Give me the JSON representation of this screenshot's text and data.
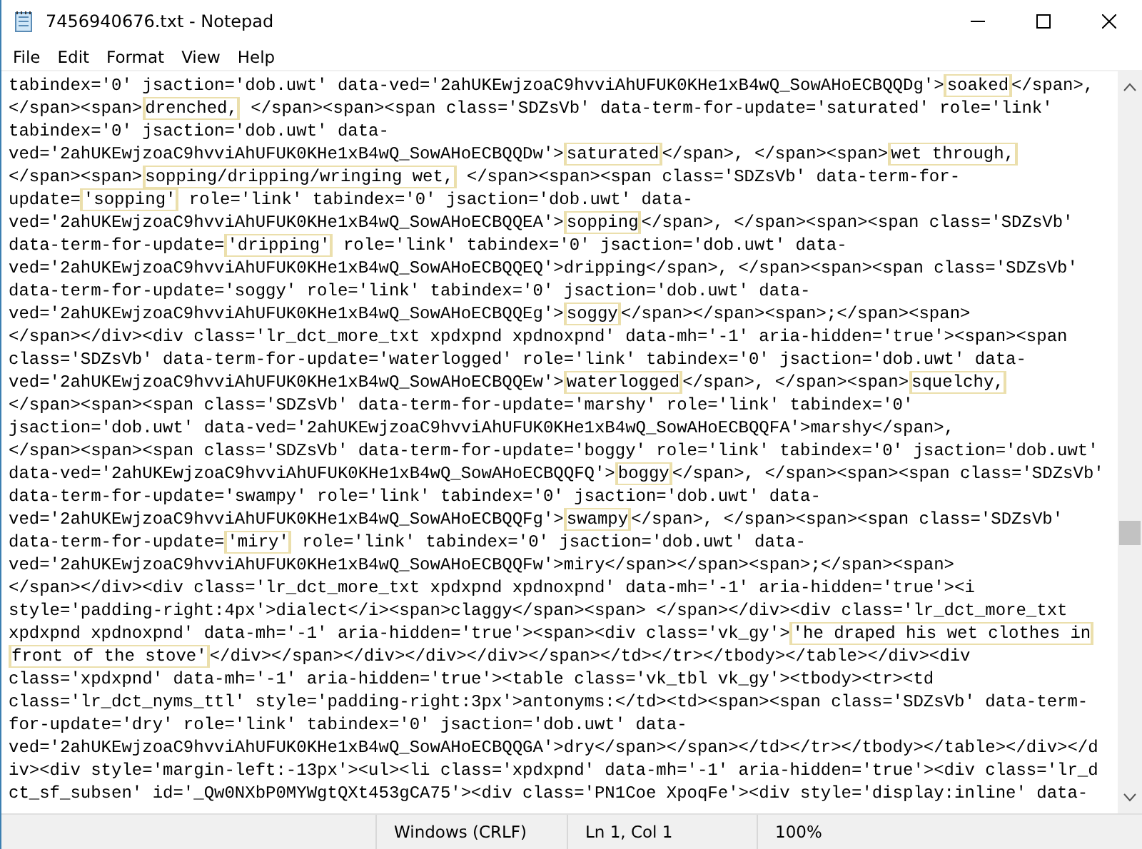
{
  "window": {
    "title": "7456940676.txt - Notepad"
  },
  "menu": [
    "File",
    "Edit",
    "Format",
    "View",
    "Help"
  ],
  "lines": [
    {
      "segments": [
        {
          "text": "tabindex='0' jsaction='dob.uwt' data-ved='2ahUKEwjzoaC9hvviAhUFUK0KHe1xB4wQ_SowAHoECBQQDg'>",
          "highlighted": false
        },
        {
          "text": "soaked",
          "highlighted": true
        },
        {
          "text": "</span>,",
          "highlighted": false
        }
      ]
    },
    {
      "segments": [
        {
          "text": "</span><span>",
          "highlighted": false
        },
        {
          "text": "drenched,",
          "highlighted": true
        },
        {
          "text": " </span><span><span class='SDZsVb' data-term-for-update='saturated' role='link'",
          "highlighted": false
        }
      ]
    },
    {
      "segments": [
        {
          "text": "tabindex='0' jsaction='dob.uwt' data-",
          "highlighted": false
        }
      ]
    },
    {
      "segments": [
        {
          "text": "ved='2ahUKEwjzoaC9hvviAhUFUK0KHe1xB4wQ_SowAHoECBQQDw'>",
          "highlighted": false
        },
        {
          "text": "saturated",
          "highlighted": true
        },
        {
          "text": "</span>, </span><span>",
          "highlighted": false
        },
        {
          "text": "wet through,",
          "highlighted": true
        }
      ]
    },
    {
      "segments": [
        {
          "text": "</span><span>",
          "highlighted": false
        },
        {
          "text": "sopping/dripping/wringing wet,",
          "highlighted": true
        },
        {
          "text": " </span><span><span class='SDZsVb' data-term-for-",
          "highlighted": false
        }
      ]
    },
    {
      "segments": [
        {
          "text": "update=",
          "highlighted": false
        },
        {
          "text": "'sopping'",
          "highlighted": true
        },
        {
          "text": " role='link' tabindex='0' jsaction='dob.uwt' data-",
          "highlighted": false
        }
      ]
    },
    {
      "segments": [
        {
          "text": "ved='2ahUKEwjzoaC9hvviAhUFUK0KHe1xB4wQ_SowAHoECBQQEA'>",
          "highlighted": false
        },
        {
          "text": "sopping",
          "highlighted": true
        },
        {
          "text": "</span>, </span><span><span class='SDZsVb'",
          "highlighted": false
        }
      ]
    },
    {
      "segments": [
        {
          "text": "data-term-for-update=",
          "highlighted": false
        },
        {
          "text": "'dripping'",
          "highlighted": true
        },
        {
          "text": " role='link' tabindex='0' jsaction='dob.uwt' data-",
          "highlighted": false
        }
      ]
    },
    {
      "segments": [
        {
          "text": "ved='2ahUKEwjzoaC9hvviAhUFUK0KHe1xB4wQ_SowAHoECBQQEQ'>dripping</span>, </span><span><span class='SDZsVb'",
          "highlighted": false
        }
      ]
    },
    {
      "segments": [
        {
          "text": "data-term-for-update='soggy' role='link' tabindex='0' jsaction='dob.uwt' data-",
          "highlighted": false
        }
      ]
    },
    {
      "segments": [
        {
          "text": "ved='2ahUKEwjzoaC9hvviAhUFUK0KHe1xB4wQ_SowAHoECBQQEg'>",
          "highlighted": false
        },
        {
          "text": "soggy",
          "highlighted": true
        },
        {
          "text": "</span></span><span>;</span><span>",
          "highlighted": false
        }
      ]
    },
    {
      "segments": [
        {
          "text": "</span></div><div class='lr_dct_more_txt xpdxpnd xpdnoxpnd' data-mh='-1' aria-hidden='true'><span><span",
          "highlighted": false
        }
      ]
    },
    {
      "segments": [
        {
          "text": "class='SDZsVb' data-term-for-update='waterlogged' role='link' tabindex='0' jsaction='dob.uwt' data-",
          "highlighted": false
        }
      ]
    },
    {
      "segments": [
        {
          "text": "ved='2ahUKEwjzoaC9hvviAhUFUK0KHe1xB4wQ_SowAHoECBQQEw'>",
          "highlighted": false
        },
        {
          "text": "waterlogged",
          "highlighted": true
        },
        {
          "text": "</span>, </span><span>",
          "highlighted": false
        },
        {
          "text": "squelchy,",
          "highlighted": true
        }
      ]
    },
    {
      "segments": [
        {
          "text": "</span><span><span class='SDZsVb' data-term-for-update='marshy' role='link' tabindex='0'",
          "highlighted": false
        }
      ]
    },
    {
      "segments": [
        {
          "text": "jsaction='dob.uwt' data-ved='2ahUKEwjzoaC9hvviAhUFUK0KHe1xB4wQ_SowAHoECBQQFA'>marshy</span>,",
          "highlighted": false
        }
      ]
    },
    {
      "segments": [
        {
          "text": "</span><span><span class='SDZsVb' data-term-for-update='boggy' role='link' tabindex='0' jsaction='dob.uwt'",
          "highlighted": false
        }
      ]
    },
    {
      "segments": [
        {
          "text": "data-ved='2ahUKEwjzoaC9hvviAhUFUK0KHe1xB4wQ_SowAHoECBQQFQ'>",
          "highlighted": false
        },
        {
          "text": "boggy",
          "highlighted": true
        },
        {
          "text": "</span>, </span><span><span class='SDZsVb'",
          "highlighted": false
        }
      ]
    },
    {
      "segments": [
        {
          "text": "data-term-for-update='swampy' role='link' tabindex='0' jsaction='dob.uwt' data-",
          "highlighted": false
        }
      ]
    },
    {
      "segments": [
        {
          "text": "ved='2ahUKEwjzoaC9hvviAhUFUK0KHe1xB4wQ_SowAHoECBQQFg'>",
          "highlighted": false
        },
        {
          "text": "swampy",
          "highlighted": true
        },
        {
          "text": "</span>, </span><span><span class='SDZsVb'",
          "highlighted": false
        }
      ]
    },
    {
      "segments": [
        {
          "text": "data-term-for-update=",
          "highlighted": false
        },
        {
          "text": "'miry'",
          "highlighted": true
        },
        {
          "text": " role='link' tabindex='0' jsaction='dob.uwt' data-",
          "highlighted": false
        }
      ]
    },
    {
      "segments": [
        {
          "text": "ved='2ahUKEwjzoaC9hvviAhUFUK0KHe1xB4wQ_SowAHoECBQQFw'>miry</span></span><span>;</span><span>",
          "highlighted": false
        }
      ]
    },
    {
      "segments": [
        {
          "text": "</span></div><div class='lr_dct_more_txt xpdxpnd xpdnoxpnd' data-mh='-1' aria-hidden='true'><i",
          "highlighted": false
        }
      ]
    },
    {
      "segments": [
        {
          "text": "style='padding-right:4px'>dialect</i><span>claggy</span><span> </span></div><div class='lr_dct_more_txt",
          "highlighted": false
        }
      ]
    },
    {
      "segments": [
        {
          "text": "xpdxpnd xpdnoxpnd' data-mh='-1' aria-hidden='true'><span><div class='vk_gy'>",
          "highlighted": false
        },
        {
          "text": "'he draped his wet clothes in",
          "highlighted": true
        }
      ]
    },
    {
      "segments": [
        {
          "text": "front of the stove'",
          "highlighted": true
        },
        {
          "text": "</div></span></div></div></div></span></td></tr></tbody></table></div><div",
          "highlighted": false
        }
      ]
    },
    {
      "segments": [
        {
          "text": "class='xpdxpnd' data-mh='-1' aria-hidden='true'><table class='vk_tbl vk_gy'><tbody><tr><td",
          "highlighted": false
        }
      ]
    },
    {
      "segments": [
        {
          "text": "class='lr_dct_nyms_ttl' style='padding-right:3px'>antonyms:</td><td><span><span class='SDZsVb' data-term-",
          "highlighted": false
        }
      ]
    },
    {
      "segments": [
        {
          "text": "for-update='dry' role='link' tabindex='0' jsaction='dob.uwt' data-",
          "highlighted": false
        }
      ]
    },
    {
      "segments": [
        {
          "text": "ved='2ahUKEwjzoaC9hvviAhUFUK0KHe1xB4wQ_SowAHoECBQQGA'>dry</span></span></td></tr></tbody></table></div></d",
          "highlighted": false
        }
      ]
    },
    {
      "segments": [
        {
          "text": "iv><div style='margin-left:-13px'><ul><li class='xpdxpnd' data-mh='-1' aria-hidden='true'><div class='lr_d",
          "highlighted": false
        }
      ]
    },
    {
      "segments": [
        {
          "text": "ct_sf_subsen' id='_Qw0NXbP0MYWgtQXt453gCA75'><div class='PN1Coe XpoqFe'><div style='display:inline' data-",
          "highlighted": false
        }
      ]
    }
  ],
  "status_bar": {
    "line_ending": "Windows (CRLF)",
    "position": "Ln 1, Col 1",
    "zoom": "100%"
  }
}
